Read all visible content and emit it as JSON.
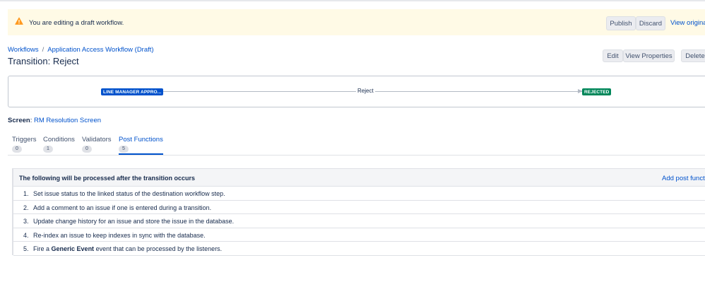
{
  "banner": {
    "message": "You are editing a draft workflow.",
    "publish_label": "Publish",
    "discard_label": "Discard",
    "view_original_label": "View original"
  },
  "breadcrumb": {
    "root": "Workflows",
    "separator": "/",
    "current": "Application Access Workflow (Draft)"
  },
  "page_title": "Transition: Reject",
  "header_actions": {
    "edit_label": "Edit",
    "view_properties_label": "View Properties",
    "delete_label": "Delete"
  },
  "diagram": {
    "from_status": "LINE MANAGER APPRO...",
    "transition_name": "Reject",
    "to_status": "REJECTED"
  },
  "screen": {
    "label": "Screen",
    "colon": ":",
    "value": "RM Resolution Screen"
  },
  "tabs": [
    {
      "label": "Triggers",
      "count": "0"
    },
    {
      "label": "Conditions",
      "count": "1"
    },
    {
      "label": "Validators",
      "count": "0"
    },
    {
      "label": "Post Functions",
      "count": "5"
    }
  ],
  "post_functions": {
    "header": "The following will be processed after the transition occurs",
    "add_label": "Add post function",
    "items": [
      {
        "num": "1.",
        "text": "Set issue status to the linked status of the destination workflow step."
      },
      {
        "num": "2.",
        "text": "Add a comment to an issue if one is entered during a transition."
      },
      {
        "num": "3.",
        "text": "Update change history for an issue and store the issue in the database."
      },
      {
        "num": "4.",
        "text": "Re-index an issue to keep indexes in sync with the database."
      },
      {
        "num": "5.",
        "prefix": "Fire a",
        "bold": "Generic Event",
        "suffix": "event that can be processed by the listeners."
      }
    ]
  },
  "colors": {
    "accent": "#0052cc",
    "banner_bg": "#fffae6",
    "warning": "#ff991f",
    "status_from": "#0052cc",
    "status_to": "#00875a"
  },
  "icons": {
    "banner": "warning-icon"
  }
}
